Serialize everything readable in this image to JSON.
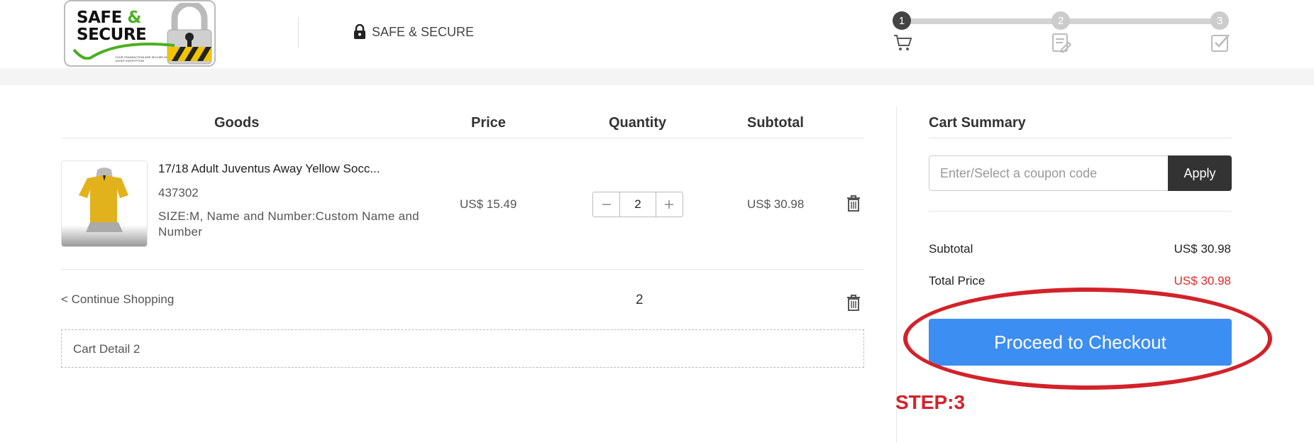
{
  "header": {
    "logo": {
      "line1": "SAFE",
      "line1_amp": "&",
      "line2": "SECURE",
      "fineprint": "YOUR TRANSACTION ARE SECURE WITH SSL 128 BIT ENCRYPTION"
    },
    "secure_label": "SAFE & SECURE",
    "steps": [
      {
        "number": "1",
        "icon": "cart-icon",
        "active": true
      },
      {
        "number": "2",
        "icon": "edit-form-icon",
        "active": false
      },
      {
        "number": "3",
        "icon": "checkbox-icon",
        "active": false
      }
    ]
  },
  "table": {
    "columns": [
      "Goods",
      "Price",
      "Quantity",
      "Subtotal"
    ],
    "item": {
      "name": "17/18 Adult Juventus Away Yellow Socc...",
      "sku": "437302",
      "options": "SIZE:M, Name and Number:Custom Name and Number",
      "price": "US$ 15.49",
      "quantity": "2",
      "subtotal": "US$ 30.98"
    },
    "continue_shopping": "< Continue Shopping",
    "total_quantity": "2",
    "cart_detail": "Cart Detail 2"
  },
  "summary": {
    "title": "Cart Summary",
    "coupon_placeholder": "Enter/Select a coupon code",
    "apply_label": "Apply",
    "subtotal_label": "Subtotal",
    "subtotal_value": "US$  30.98",
    "total_label": "Total Price",
    "total_value": "US$  30.98",
    "checkout_label": "Proceed to Checkout"
  },
  "annotation": "STEP:3",
  "colors": {
    "accent": "#3d8ef2",
    "annotation": "#d3222a",
    "total_price": "#e12b2b",
    "dark_button": "#333333"
  }
}
